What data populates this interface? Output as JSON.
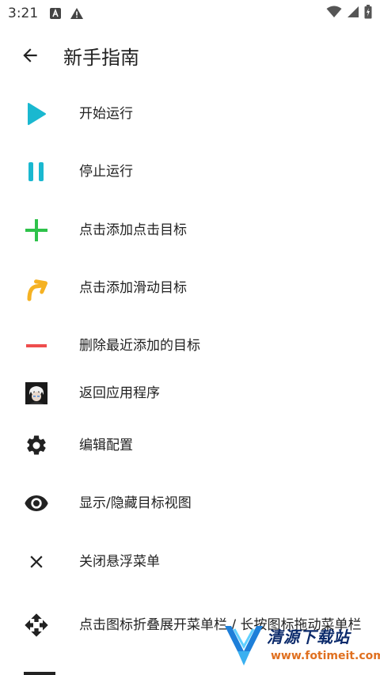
{
  "status_bar": {
    "time": "3:21"
  },
  "app_bar": {
    "title": "新手指南"
  },
  "items": [
    {
      "label": "开始运行",
      "icon": "play-icon",
      "color": "#1ab8d0"
    },
    {
      "label": "停止运行",
      "icon": "pause-icon",
      "color": "#1ab8d0"
    },
    {
      "label": "点击添加点击目标",
      "icon": "plus-icon",
      "color": "#2ec24a"
    },
    {
      "label": "点击添加滑动目标",
      "icon": "swipe-arrow-icon",
      "color": "#f5b223"
    },
    {
      "label": "删除最近添加的目标",
      "icon": "minus-icon",
      "color": "#ee4d4d"
    },
    {
      "label": "返回应用程序",
      "icon": "app-avatar-icon",
      "color": "#333333"
    },
    {
      "label": "编辑配置",
      "icon": "gear-icon",
      "color": "#222222"
    },
    {
      "label": "显示/隐藏目标视图",
      "icon": "eye-icon",
      "color": "#222222"
    },
    {
      "label": "关闭悬浮菜单",
      "icon": "close-icon",
      "color": "#222222"
    },
    {
      "label": "点击图标折叠展开菜单栏 / 长按图标拖动菜单栏",
      "icon": "move-icon",
      "color": "#222222"
    }
  ],
  "watermark": {
    "brand": "清源下载站",
    "url": "www.fotimeit.com"
  }
}
